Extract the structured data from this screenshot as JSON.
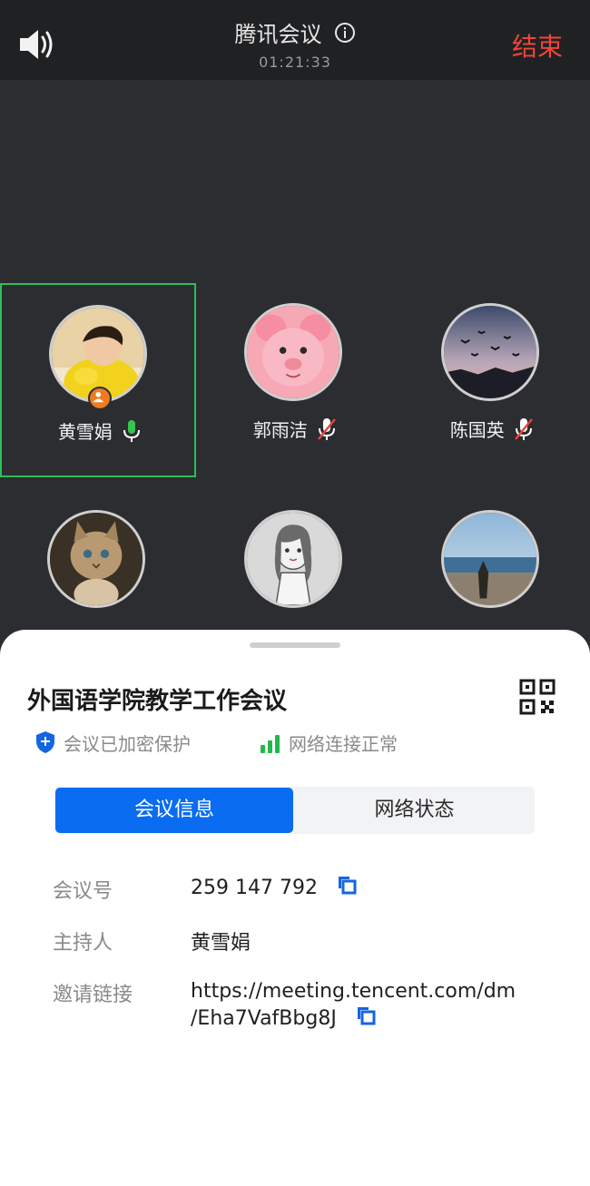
{
  "header": {
    "title": "腾讯会议",
    "timer": "01:21:33",
    "end_label": "结束"
  },
  "participants": [
    {
      "name": "黄雪娟",
      "mic": "active",
      "host": true,
      "active": true,
      "avatar": "child-photo"
    },
    {
      "name": "郭雨洁",
      "mic": "muted",
      "avatar": "pink-cartoon-pig"
    },
    {
      "name": "陈国英",
      "mic": "muted",
      "avatar": "sunset-birds"
    },
    {
      "name": "",
      "mic": "on",
      "avatar": "kitten"
    },
    {
      "name": "",
      "mic": "muted",
      "avatar": "sketch-girl"
    },
    {
      "name": "",
      "mic": "on",
      "avatar": "beach"
    }
  ],
  "sheet": {
    "meeting_title": "外国语学院教学工作会议",
    "encrypted_label": "会议已加密保护",
    "network_label": "网络连接正常",
    "tabs": [
      {
        "label": "会议信息",
        "selected": true
      },
      {
        "label": "网络状态",
        "selected": false
      }
    ],
    "info": {
      "id_label": "会议号",
      "id_value": "259 147 792",
      "host_label": "主持人",
      "host_value": "黄雪娟",
      "link_label": "邀请链接",
      "link_line1": "https://meeting.tencent.com/dm",
      "link_line2": "/Eha7VafBbg8J"
    }
  },
  "colors": {
    "accent": "#0a6cf0",
    "end": "#f0453a",
    "active_border": "#2bbf5a",
    "mic_active": "#36c451",
    "muted_slash": "#e8443a"
  }
}
